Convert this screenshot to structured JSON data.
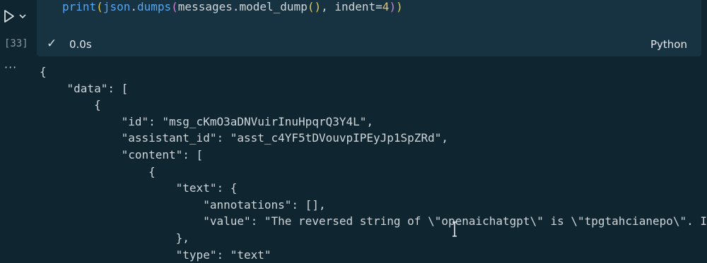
{
  "cell": {
    "execution_count": "[33]",
    "code": {
      "fn": "print",
      "open1": "(",
      "obj": "json",
      "dot1": ".",
      "method": "dumps",
      "open2": "(",
      "arg": "messages.model_dump",
      "call": "()",
      "sep": ", indent=",
      "num": "4",
      "close2": ")",
      "close1": ")"
    },
    "status": {
      "duration": "0.0s",
      "language": "Python"
    },
    "output_menu": "···"
  },
  "output": {
    "lines": [
      "{",
      "    \"data\": [",
      "        {",
      "            \"id\": \"msg_cKmO3aDNVuirInuHpqrQ3Y4L\",",
      "            \"assistant_id\": \"asst_c4YF5tDVouvpIPEyJp1SpZRd\",",
      "            \"content\": [",
      "                {",
      "                    \"text\": {",
      "                        \"annotations\": [],",
      "                        \"value\": \"The reversed string of \\\"openaichatgpt\\\" is \\\"tpgtahcianepo\\\". In",
      "                    },",
      "                    \"type\": \"text\""
    ]
  },
  "colors": {
    "background": "#0f2530",
    "cell_background": "#173240",
    "function": "#58a6f0",
    "number": "#e8c36a"
  },
  "icons": {
    "run": "run-icon",
    "chevron": "chevron-down-icon",
    "check": "check-icon",
    "cursor": "text-cursor-icon"
  }
}
